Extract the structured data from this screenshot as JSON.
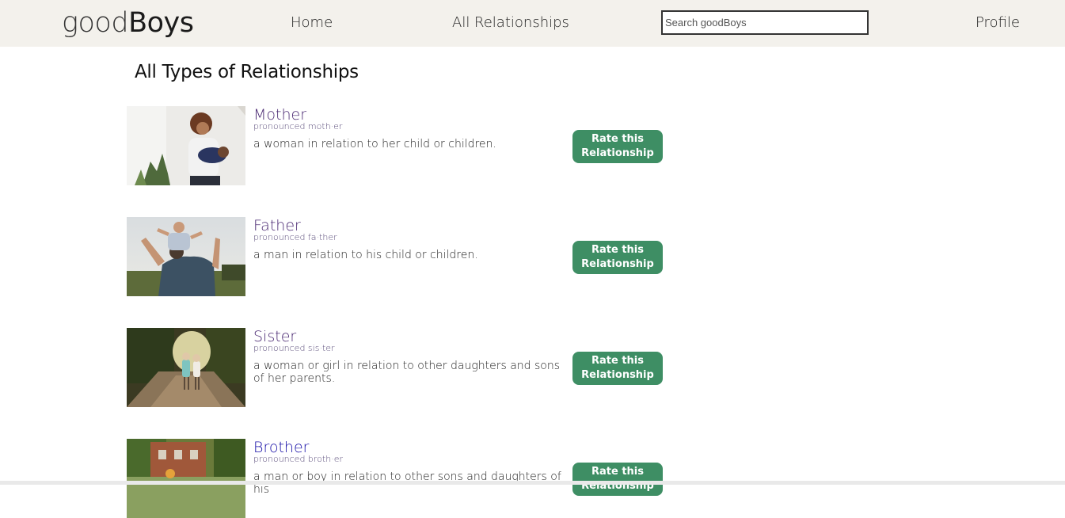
{
  "nav": {
    "logo_light": "good",
    "logo_bold": "Boys",
    "home": "Home",
    "all_relationships": "All Relationships",
    "search_placeholder": "Search goodBoys",
    "profile": "Profile"
  },
  "main": {
    "title": "All Types of Relationships",
    "rate_label": "Rate this Relationship",
    "relationships": [
      {
        "name": "Mother",
        "pronunciation": "pronounced moth·er",
        "description": "a woman in relation to her child or children.",
        "image_icon": "mother-photo"
      },
      {
        "name": "Father",
        "pronunciation": "pronounced fa·ther",
        "description": "a man in relation to his child or children.",
        "image_icon": "father-photo"
      },
      {
        "name": "Sister",
        "pronunciation": "pronounced sis·ter",
        "description": "a woman or girl in relation to other daughters and sons of her parents.",
        "image_icon": "sister-photo"
      },
      {
        "name": "Brother",
        "pronunciation": "pronounced broth·er",
        "description": "a man or boy in relation to other sons and daughters of his",
        "image_icon": "brother-photo"
      }
    ]
  },
  "colors": {
    "navbar_bg": "#f3f1ec",
    "button_bg": "#3e8e64",
    "link": "#4b2a73",
    "visited_link": "#1a12a8"
  }
}
